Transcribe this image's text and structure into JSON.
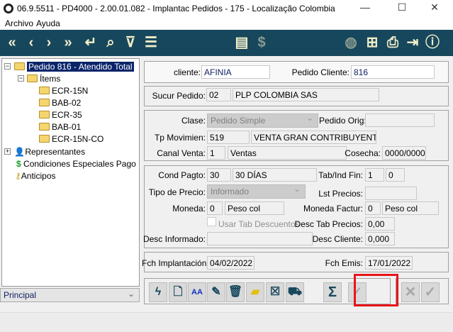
{
  "window": {
    "title": "06.9.5511 - PD4000 - 2.00.01.082 - Implantac Pedidos - 175 - Localização Colombia"
  },
  "menu": [
    "Archivo",
    "Ayuda"
  ],
  "toolbar_icons": [
    "first-icon",
    "prev-icon",
    "next-icon",
    "last-icon",
    "enter-icon",
    "search-icon",
    "filter-icon",
    "settings-icon",
    "document-check-icon",
    "dollar-check-icon",
    "globe-search-icon",
    "hierarchy-icon",
    "print-icon",
    "exit-icon",
    "help-icon"
  ],
  "tree": {
    "root": "Pedido 816 - Atendido Total",
    "items_label": "Ítems",
    "items": [
      "ECR-15N",
      "BAB-02",
      "ECR-35",
      "BAB-01",
      "ECR-15N-CO"
    ],
    "representantes": "Representantes",
    "condiciones": "Condiciones Especiales Pago",
    "anticipos": "Anticipos"
  },
  "view_select": "Principal",
  "form": {
    "cliente_label": "cliente:",
    "cliente": "AFINIA",
    "pedido_cliente_label": "Pedido Cliente:",
    "pedido_cliente": "816",
    "sucur_label": "Sucur Pedido:",
    "sucur_code": "02",
    "sucur_name": "PLP COLOMBIA SAS",
    "clase_label": "Clase:",
    "clase": "Pedido Simple",
    "pedido_orig_label": "Pedido Orig:",
    "pedido_orig": "",
    "tp_label": "Tp Movimien:",
    "tp_code": "519",
    "tp_name": "VENTA GRAN CONTRIBUYENTE",
    "canal_label": "Canal Venta:",
    "canal_code": "1",
    "canal_name": "Ventas",
    "cosecha_label": "Cosecha:",
    "cosecha": "0000/0000",
    "cond_label": "Cond Pagto:",
    "cond_code": "30",
    "cond_name": "30 DÍAS",
    "tab_label": "Tab/Ind Fin:",
    "tab1": "1",
    "tab2": "0",
    "tipo_precio_label": "Tipo de Precio:",
    "tipo_precio": "Informado",
    "lst_label": "Lst Precios:",
    "lst": "",
    "moneda_label": "Moneda:",
    "moneda_code": "0",
    "moneda_name": "Peso col",
    "moneda_fact_label": "Moneda Factur:",
    "moneda_fact_code": "0",
    "moneda_fact_name": "Peso col",
    "usar_tab_label": "Usar Tab Descuentos",
    "desc_tab_label": "Desc Tab Precios:",
    "desc_tab": "0,00",
    "desc_inf_label": "Desc Informado:",
    "desc_inf": "",
    "desc_cli_label": "Desc Cliente:",
    "desc_cli": "0,000",
    "fch_impl_label": "Fch Implantación:",
    "fch_impl": "04/02/2022",
    "fch_emis_label": "Fch Emis:",
    "fch_emis": "17/01/2022"
  },
  "highlight_color": "#e8141a"
}
